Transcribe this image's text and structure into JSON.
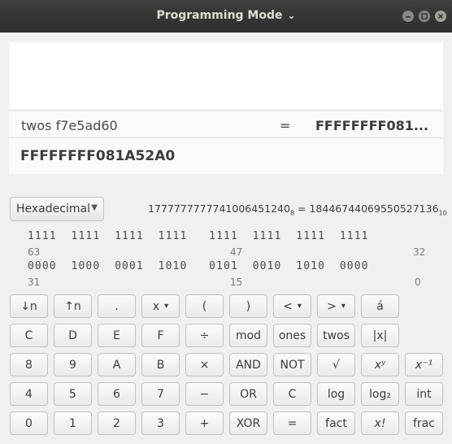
{
  "window": {
    "title": "Programming Mode",
    "title_chevron": "⌄"
  },
  "history": {
    "expression": "twos f7e5ad60",
    "equals": "=",
    "result": "FFFFFFFF081..."
  },
  "display": {
    "value": "FFFFFFFF081A52A0"
  },
  "base_selector": {
    "selected": "Hexadecimal"
  },
  "conversion": {
    "octal": "1777777777741006451240",
    "octal_base": "8",
    "equals": " = ",
    "decimal": "18446744069550527136",
    "decimal_base": "10"
  },
  "bit_display": {
    "upper_bits": "1111  1111  1111  1111   1111  1111  1111  1111",
    "upper_index": [
      "63",
      "47",
      "32"
    ],
    "lower_bits": "0000  1000  0001  1010   0101  0010  1010  0000",
    "lower_index": [
      "31",
      "15",
      "0"
    ]
  },
  "keypad": {
    "row1": [
      "↓n",
      "↑n",
      ".",
      "x",
      "(",
      ")",
      "<",
      ">",
      "á"
    ],
    "row2": [
      "C",
      "D",
      "E",
      "F",
      "÷",
      "mod",
      "ones",
      "twos",
      "|x|"
    ],
    "row3": [
      "8",
      "9",
      "A",
      "B",
      "×",
      "AND",
      "NOT",
      "√",
      "xʸ",
      "x⁻¹"
    ],
    "row4": [
      "4",
      "5",
      "6",
      "7",
      "−",
      "OR",
      "C",
      "log",
      "log₂",
      "int"
    ],
    "row5": [
      "0",
      "1",
      "2",
      "3",
      "+",
      "XOR",
      "=",
      "fact",
      "x!",
      "frac"
    ]
  }
}
